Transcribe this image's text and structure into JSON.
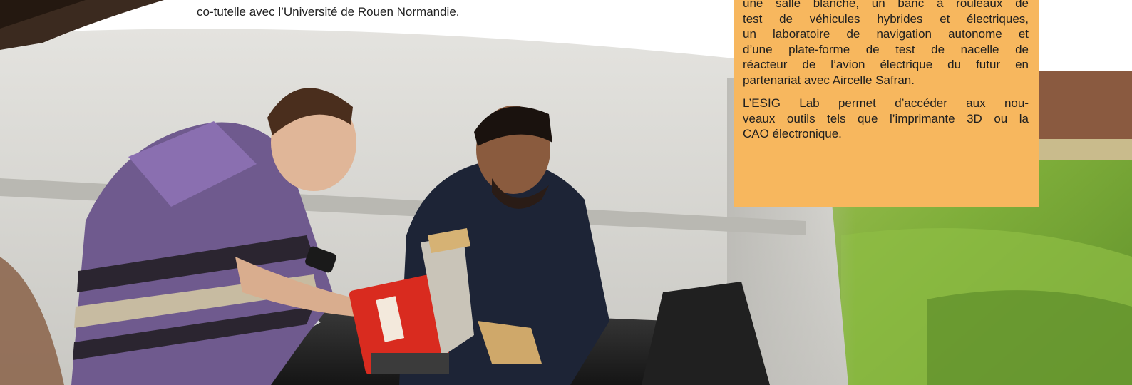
{
  "intro": {
    "last_line": "co-tutelle avec l’Université de Rouen Normandie."
  },
  "orange_box": {
    "paragraph1_lines": [
      "une salle blanche, un banc à rouleaux de",
      "test de véhicules hybrides et électriques,",
      "un laboratoire de navigation autonome et",
      "d’une plate-forme de test de nacelle de",
      "réacteur de l’avion électrique du futur en",
      "partenariat avec Aircelle Safran."
    ],
    "paragraph2_lines": [
      "L’ESIG Lab permet d’accéder aux nou-",
      "veaux outils tels que l’imprimante 3D ou la",
      "CAO électronique."
    ]
  },
  "colors": {
    "orange_box": "#f7b75e",
    "grass": "#7fae3a",
    "wall": "#dcdcd8"
  }
}
